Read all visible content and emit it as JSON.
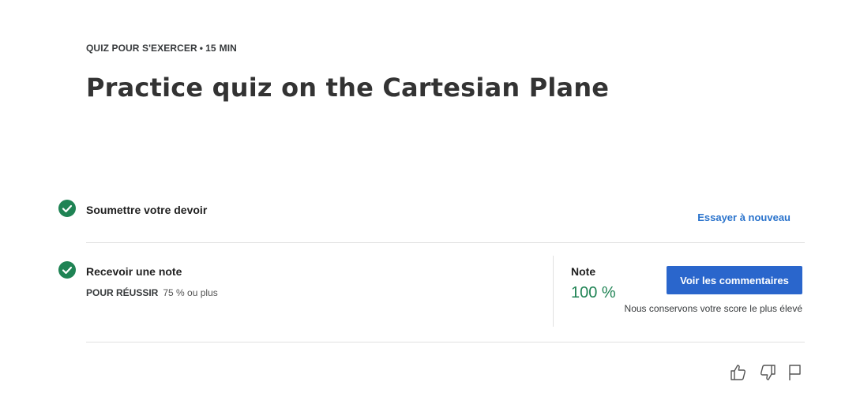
{
  "header": {
    "kind": "QUIZ POUR S'EXERCER",
    "separator": "•",
    "duration_value": "15",
    "duration_unit": "MIN",
    "title": "Practice quiz on the Cartesian Plane"
  },
  "submit_row": {
    "label": "Soumettre votre devoir",
    "retry_label": "Essayer à nouveau",
    "status_icon": "check-circle-icon"
  },
  "grade_row": {
    "label": "Recevoir une note",
    "pass_label": "POUR RÉUSSIR",
    "pass_value": "75 % ou plus",
    "grade_label": "Note",
    "grade_value": "100 %",
    "feedback_button": "Voir les commentaires",
    "keep_note": "Nous conservons votre score le plus élevé",
    "status_icon": "check-circle-icon"
  },
  "feedback_icons": [
    "thumbs-up-icon",
    "thumbs-down-icon",
    "flag-icon"
  ],
  "colors": {
    "success": "#1f8354",
    "link": "#2a73cc",
    "primary": "#2a66cc",
    "divider": "#e1e1e1"
  }
}
